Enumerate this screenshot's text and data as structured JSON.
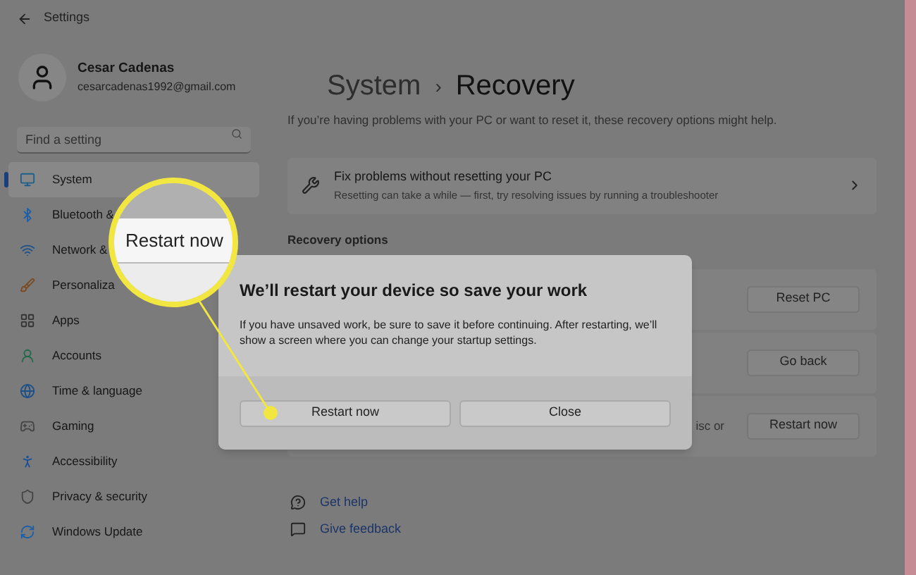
{
  "window": {
    "title": "Settings"
  },
  "user": {
    "name": "Cesar Cadenas",
    "email": "cesarcadenas1992@gmail.com"
  },
  "search": {
    "placeholder": "Find a setting"
  },
  "sidebar": {
    "items": [
      {
        "label": "System",
        "selected": true
      },
      {
        "label": "Bluetooth &",
        "selected": false
      },
      {
        "label": "Network &",
        "selected": false
      },
      {
        "label": "Personaliza",
        "selected": false
      },
      {
        "label": "Apps",
        "selected": false
      },
      {
        "label": "Accounts",
        "selected": false
      },
      {
        "label": "Time & language",
        "selected": false
      },
      {
        "label": "Gaming",
        "selected": false
      },
      {
        "label": "Accessibility",
        "selected": false
      },
      {
        "label": "Privacy & security",
        "selected": false
      },
      {
        "label": "Windows Update",
        "selected": false
      }
    ]
  },
  "page": {
    "breadcrumb": [
      "System",
      "Recovery"
    ],
    "separator": "›",
    "subtitle": "If you’re having problems with your PC or want to reset it, these recovery options might help."
  },
  "fix_card": {
    "title": "Fix problems without resetting your PC",
    "description": "Resetting can take a while — first, try resolving issues by running a troubleshooter"
  },
  "recovery_options": {
    "heading": "Recovery options",
    "rows": [
      {
        "button": "Reset PC"
      },
      {
        "button": "Go back"
      },
      {
        "text": "isc or",
        "button": "Restart now"
      }
    ]
  },
  "links": [
    "Get help",
    "Give feedback"
  ],
  "dialog": {
    "title": "We’ll restart your device so save your work",
    "message": "If you have unsaved work, be sure to save it before continuing. After restarting, we’ll show a screen where you can change your startup settings.",
    "buttons": [
      {
        "label": "Restart now"
      },
      {
        "label": "Close"
      }
    ]
  },
  "magnifier": {
    "label": "Restart now"
  }
}
